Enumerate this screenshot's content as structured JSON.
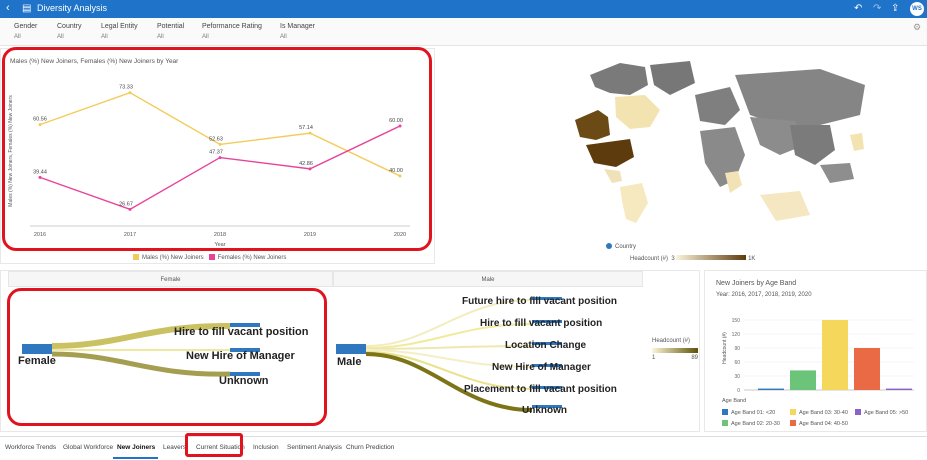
{
  "app": {
    "title": "Diversity Analysis",
    "user_initials": "WS"
  },
  "filters": [
    {
      "label": "Gender",
      "value": "All"
    },
    {
      "label": "Country",
      "value": "All"
    },
    {
      "label": "Legal Entity",
      "value": "All"
    },
    {
      "label": "Potential",
      "value": "All"
    },
    {
      "label": "Peformance Rating",
      "value": "All"
    },
    {
      "label": "Is Manager",
      "value": "All"
    }
  ],
  "line_chart": {
    "title": "Males (%) New Joiners, Females (%) New Joiners by Year",
    "xlabel": "Year",
    "ylabel": "Males (%) New Joiners, Females (%) New Joiners",
    "legend": [
      "Males (%) New Joiners",
      "Females (%) New Joiners"
    ]
  },
  "map": {
    "legend_series": "Country",
    "legend_measure": "Headcount (#)",
    "legend_min": "3",
    "legend_max": "1K"
  },
  "sankey": {
    "header_female": "Female",
    "header_male": "Male",
    "female_node": "Female",
    "male_node": "Male",
    "female_targets": [
      "Hire to fill vacant position",
      "New Hire of Manager",
      "Unknown"
    ],
    "male_targets": [
      "Future hire to fill vacant position",
      "Hire to fill vacant position",
      "Location Change",
      "New Hire of Manager",
      "Placement to fill vacant position",
      "Unknown"
    ],
    "legend_title": "Headcount (#)",
    "legend_min": "1",
    "legend_max": "89"
  },
  "bar_chart": {
    "title": "New Joiners by Age Band",
    "subtitle": "Year: 2016, 2017, 2018, 2019, 2020",
    "ylabel": "Headcount (#)",
    "legend_title": "Age Band",
    "legend": [
      "Age Band 01: <20",
      "Age Band 02: 20-30",
      "Age Band 03: 30-40",
      "Age Band 04: 40-50",
      "Age Band 05: >50"
    ]
  },
  "tabs": [
    "Workforce Trends",
    "Global Workforce",
    "New Joiners",
    "Leavers",
    "Current Situation",
    "Inclusion",
    "Sentiment Analysis",
    "Churn Prediction"
  ],
  "colors": {
    "accent": "#1f73c8",
    "male_line": "#f2cc5a",
    "female_line": "#e8439b",
    "highlight": "#e0141e"
  },
  "chart_data": [
    {
      "type": "line",
      "title": "Males (%) New Joiners, Females (%) New Joiners by Year",
      "xlabel": "Year",
      "ylabel": "Males (%) New Joiners, Females (%) New Joiners",
      "x": [
        "2016",
        "2017",
        "2018",
        "2019",
        "2020"
      ],
      "series": [
        {
          "name": "Males (%) New Joiners",
          "values": [
            60.56,
            73.33,
            52.63,
            57.14,
            40.0
          ],
          "color": "#f2cc5a"
        },
        {
          "name": "Females (%) New Joiners",
          "values": [
            39.44,
            26.67,
            47.37,
            42.86,
            60.0
          ],
          "color": "#e8439b"
        }
      ],
      "ylim": [
        20,
        80
      ],
      "legend": "bottom"
    },
    {
      "type": "bar",
      "title": "New Joiners by Age Band",
      "ylabel": "Headcount (#)",
      "categories": [
        "Age Band 01: <20",
        "Age Band 02: 20-30",
        "Age Band 03: 30-40",
        "Age Band 04: 40-50",
        "Age Band 05: >50"
      ],
      "values": [
        3,
        42,
        150,
        90,
        3
      ],
      "colors": [
        "#2f78c0",
        "#6cc47a",
        "#f5d75b",
        "#ea6a45",
        "#8a62c8"
      ],
      "yticks": [
        "0",
        "30",
        "60",
        "90",
        "120",
        "150"
      ],
      "ylim": [
        0,
        180
      ],
      "legend": "bottom"
    }
  ]
}
